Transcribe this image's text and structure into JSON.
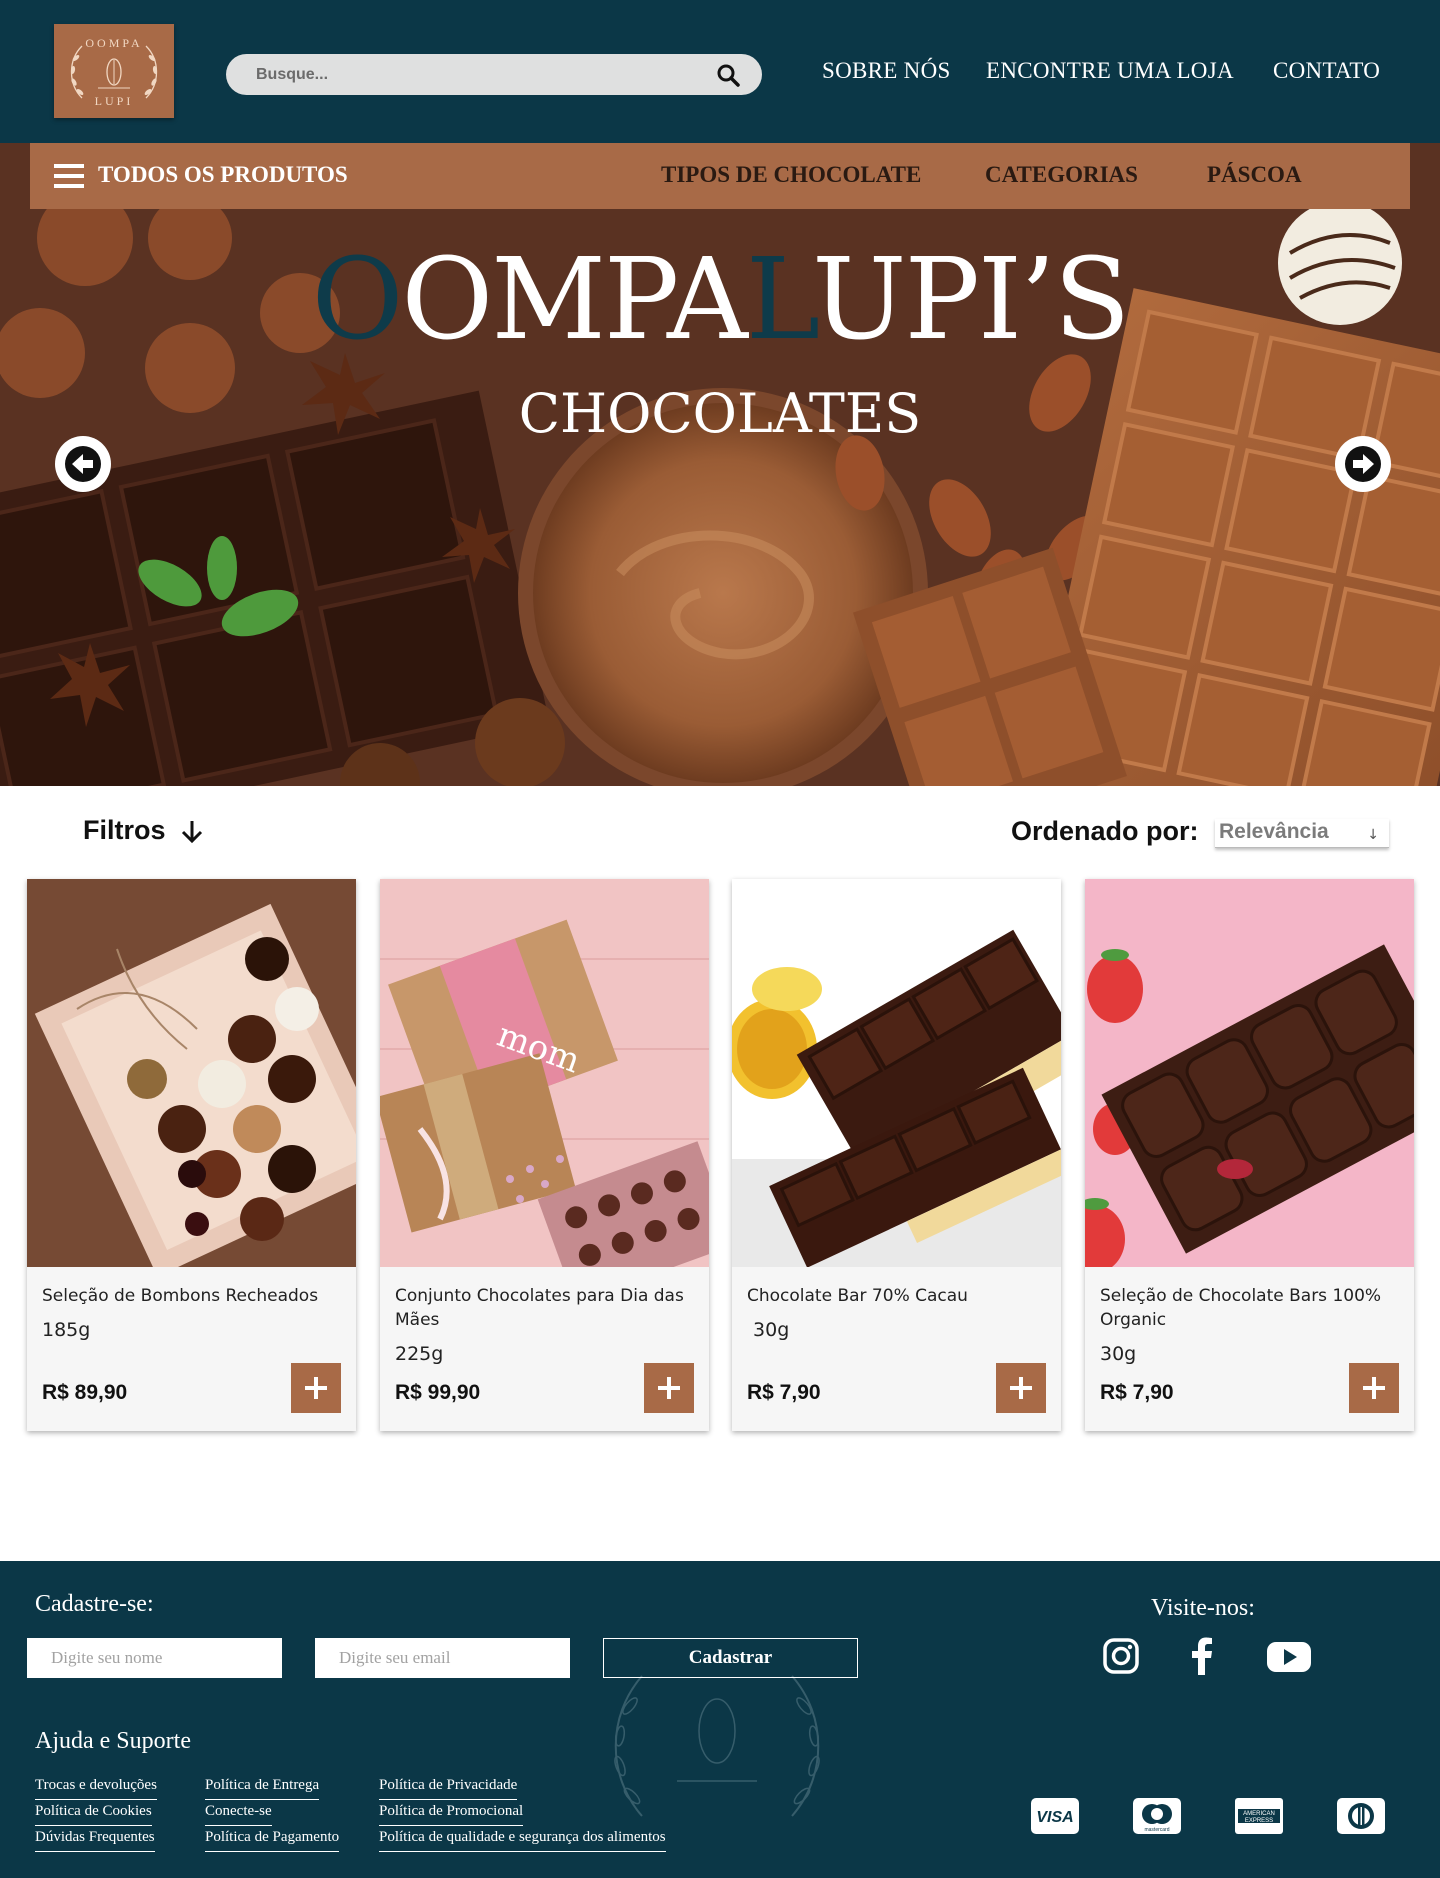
{
  "header": {
    "logo": {
      "line1": "OOMPA",
      "line2": "LUPI"
    },
    "search": {
      "placeholder": "Busque..."
    },
    "nav": [
      "SOBRE NÓS",
      "ENCONTRE UMA LOJA",
      "CONTATO"
    ]
  },
  "category_bar": {
    "all_products": "TODOS OS PRODUTOS",
    "items": [
      "TIPOS DE CHOCOLATE",
      "CATEGORIAS",
      "PÁSCOA"
    ]
  },
  "hero": {
    "brand_o": "O",
    "brand_ompa": "OMPA",
    "brand_l": "L",
    "brand_upis": "UPI’S",
    "subtitle": "CHOCOLATES",
    "prev_icon": "arrow-left-icon",
    "next_icon": "arrow-right-icon"
  },
  "toolbar": {
    "filters_label": "Filtros",
    "order_label": "Ordenado por:",
    "order_value": "Relevância"
  },
  "products": [
    {
      "name": "Seleção de Bombons Recheados",
      "weight": "185g",
      "price": "R$ 89,90"
    },
    {
      "name": "Conjunto Chocolates para Dia das Mães",
      "weight": "225g",
      "price": "R$ 99,90"
    },
    {
      "name": "Chocolate Bar 70% Cacau",
      "weight": " 30g",
      "price": "R$ 7,90"
    },
    {
      "name": "Seleção de Chocolate Bars 100% Organic",
      "weight": "30g",
      "price": "R$ 7,90"
    }
  ],
  "footer": {
    "signup_title": "Cadastre-se:",
    "name_placeholder": "Digite seu nome",
    "email_placeholder": "Digite seu email",
    "signup_button": "Cadastrar",
    "visit_title": "Visite-nos:",
    "help_title": "Ajuda e Suporte",
    "links_col1": [
      "Trocas e devoluções",
      "Política de Cookies",
      "Dúvidas Frequentes"
    ],
    "links_col2": [
      "Política de Entrega",
      "Conecte-se",
      "Política de Pagamento"
    ],
    "links_col3": [
      "Política de Privacidade",
      "Política de Promocional",
      "Política de qualidade e segurança dos alimentos"
    ],
    "social_icons": [
      "instagram-icon",
      "facebook-icon",
      "youtube-icon"
    ],
    "payment": {
      "visa": "VISA",
      "mastercard": "mastercard",
      "amex_line1": "AMERICAN",
      "amex_line2": "EXPRESS"
    }
  },
  "colors": {
    "primary_dark": "#0b3747",
    "accent_brown": "#a86a47",
    "white": "#ffffff"
  }
}
